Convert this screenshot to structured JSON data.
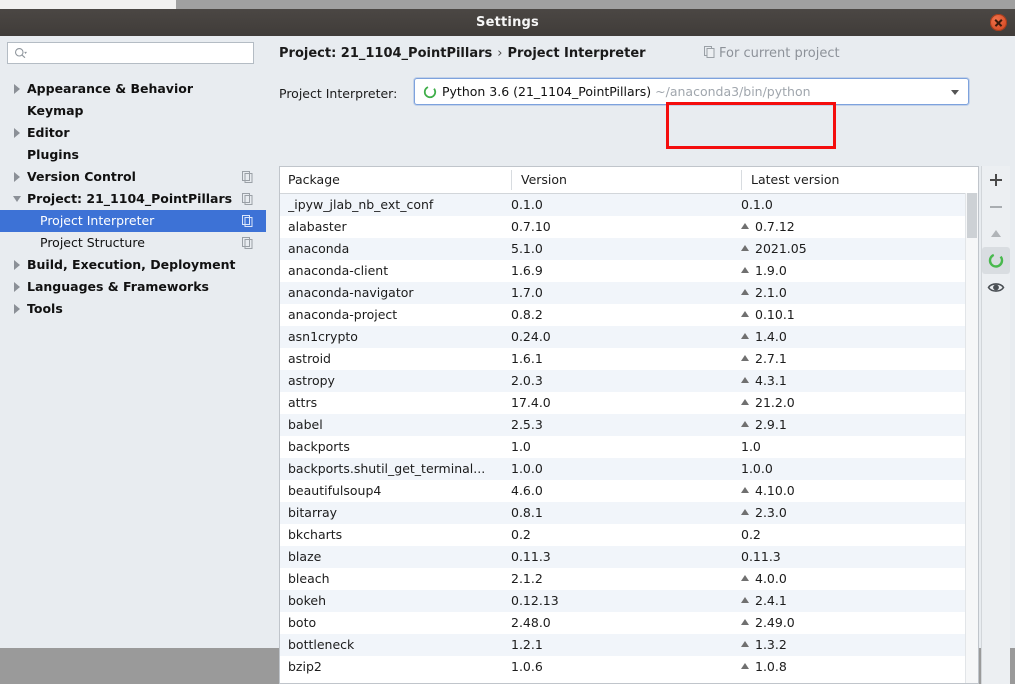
{
  "window": {
    "title": "Settings",
    "close_icon": "close-icon"
  },
  "sidebar": {
    "search": {
      "placeholder": "",
      "value": "",
      "icon": "search-icon"
    },
    "items": [
      {
        "label": "Appearance & Behavior",
        "level": 0,
        "arrow": "collapsed",
        "selected": false,
        "copy_icon": false
      },
      {
        "label": "Keymap",
        "level": 0,
        "arrow": "none",
        "selected": false,
        "copy_icon": false
      },
      {
        "label": "Editor",
        "level": 0,
        "arrow": "collapsed",
        "selected": false,
        "copy_icon": false
      },
      {
        "label": "Plugins",
        "level": 0,
        "arrow": "none",
        "selected": false,
        "copy_icon": false
      },
      {
        "label": "Version Control",
        "level": 0,
        "arrow": "collapsed",
        "selected": false,
        "copy_icon": true
      },
      {
        "label": "Project: 21_1104_PointPillars",
        "level": 0,
        "arrow": "expanded",
        "selected": false,
        "copy_icon": true
      },
      {
        "label": "Project Interpreter",
        "level": 1,
        "arrow": "none",
        "selected": true,
        "copy_icon": true
      },
      {
        "label": "Project Structure",
        "level": 1,
        "arrow": "none",
        "selected": false,
        "copy_icon": true
      },
      {
        "label": "Build, Execution, Deployment",
        "level": 0,
        "arrow": "collapsed",
        "selected": false,
        "copy_icon": false
      },
      {
        "label": "Languages & Frameworks",
        "level": 0,
        "arrow": "collapsed",
        "selected": false,
        "copy_icon": false
      },
      {
        "label": "Tools",
        "level": 0,
        "arrow": "collapsed",
        "selected": false,
        "copy_icon": false
      }
    ]
  },
  "content": {
    "breadcrumb": {
      "project": "Project: 21_1104_PointPillars",
      "separator": "›",
      "page": "Project Interpreter"
    },
    "for_current_project": {
      "label": "For current project",
      "icon": "copy-icon"
    },
    "interpreter": {
      "label": "Project Interpreter:",
      "icon": "conda-env-icon",
      "value": "Python 3.6 (21_1104_PointPillars)",
      "path": "~/anaconda3/bin/python",
      "dropdown_icon": "chevron-down-icon"
    },
    "settings_gear": {
      "icon": "gear-icon"
    },
    "annotation": {
      "color": "#f40d0d",
      "target": "interpreter-path"
    }
  },
  "table": {
    "columns": [
      "Package",
      "Version",
      "Latest version"
    ],
    "rows": [
      {
        "package": "_ipyw_jlab_nb_ext_conf",
        "version": "0.1.0",
        "latest": "0.1.0",
        "upgrade": false
      },
      {
        "package": "alabaster",
        "version": "0.7.10",
        "latest": "0.7.12",
        "upgrade": true
      },
      {
        "package": "anaconda",
        "version": "5.1.0",
        "latest": "2021.05",
        "upgrade": true
      },
      {
        "package": "anaconda-client",
        "version": "1.6.9",
        "latest": "1.9.0",
        "upgrade": true
      },
      {
        "package": "anaconda-navigator",
        "version": "1.7.0",
        "latest": "2.1.0",
        "upgrade": true
      },
      {
        "package": "anaconda-project",
        "version": "0.8.2",
        "latest": "0.10.1",
        "upgrade": true
      },
      {
        "package": "asn1crypto",
        "version": "0.24.0",
        "latest": "1.4.0",
        "upgrade": true
      },
      {
        "package": "astroid",
        "version": "1.6.1",
        "latest": "2.7.1",
        "upgrade": true
      },
      {
        "package": "astropy",
        "version": "2.0.3",
        "latest": "4.3.1",
        "upgrade": true
      },
      {
        "package": "attrs",
        "version": "17.4.0",
        "latest": "21.2.0",
        "upgrade": true
      },
      {
        "package": "babel",
        "version": "2.5.3",
        "latest": "2.9.1",
        "upgrade": true
      },
      {
        "package": "backports",
        "version": "1.0",
        "latest": "1.0",
        "upgrade": false
      },
      {
        "package": "backports.shutil_get_terminal...",
        "version": "1.0.0",
        "latest": "1.0.0",
        "upgrade": false
      },
      {
        "package": "beautifulsoup4",
        "version": "4.6.0",
        "latest": "4.10.0",
        "upgrade": true
      },
      {
        "package": "bitarray",
        "version": "0.8.1",
        "latest": "2.3.0",
        "upgrade": true
      },
      {
        "package": "bkcharts",
        "version": "0.2",
        "latest": "0.2",
        "upgrade": false
      },
      {
        "package": "blaze",
        "version": "0.11.3",
        "latest": "0.11.3",
        "upgrade": false
      },
      {
        "package": "bleach",
        "version": "2.1.2",
        "latest": "4.0.0",
        "upgrade": true
      },
      {
        "package": "bokeh",
        "version": "0.12.13",
        "latest": "2.4.1",
        "upgrade": true
      },
      {
        "package": "boto",
        "version": "2.48.0",
        "latest": "2.49.0",
        "upgrade": true
      },
      {
        "package": "bottleneck",
        "version": "1.2.1",
        "latest": "1.3.2",
        "upgrade": true
      },
      {
        "package": "bzip2",
        "version": "1.0.6",
        "latest": "1.0.8",
        "upgrade": true
      }
    ]
  },
  "toolbar": {
    "buttons": [
      {
        "name": "add-package-button",
        "icon": "plus-icon",
        "enabled": true,
        "active": false
      },
      {
        "name": "remove-package-button",
        "icon": "minus-icon",
        "enabled": false,
        "active": false
      },
      {
        "name": "upgrade-package-button",
        "icon": "triangle-up-icon",
        "enabled": false,
        "active": false
      },
      {
        "name": "conda-button",
        "icon": "conda-ring-icon",
        "enabled": true,
        "active": true
      },
      {
        "name": "show-early-releases-button",
        "icon": "eye-icon",
        "enabled": true,
        "active": false
      }
    ]
  },
  "colors": {
    "selection_blue": "#3d72d6",
    "annotation_red": "#f40d0d",
    "conda_green": "#3fae49",
    "row_alt": "#f1f5fa"
  }
}
